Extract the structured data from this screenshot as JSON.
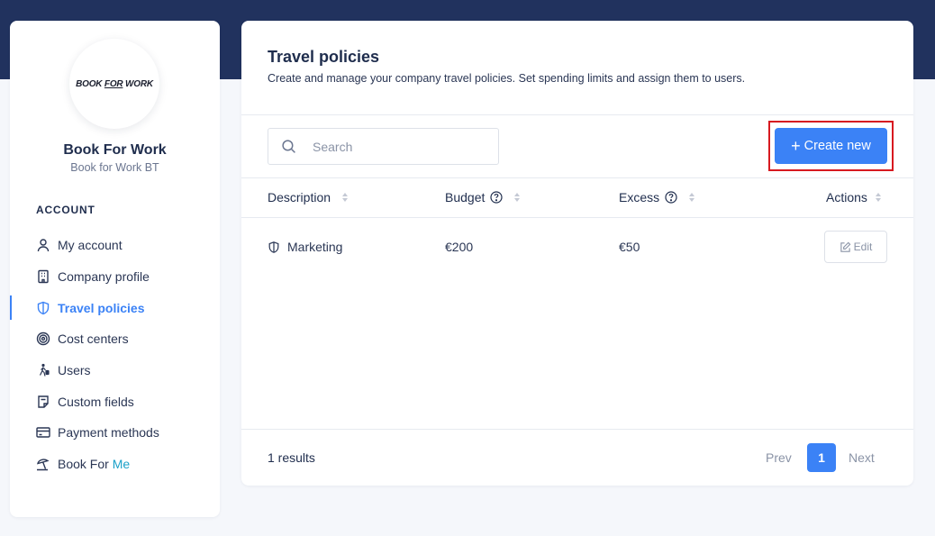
{
  "brand": {
    "logo_part1": "BOOK ",
    "logo_part2": "FOR",
    "logo_part3": " WORK",
    "company_name": "Book For Work",
    "company_sub": "Book for Work BT"
  },
  "sidebar": {
    "section_title": "ACCOUNT",
    "items": [
      {
        "label": "My account",
        "icon": "user-icon"
      },
      {
        "label": "Company profile",
        "icon": "building-icon"
      },
      {
        "label": "Travel policies",
        "icon": "shield-icon",
        "active": true
      },
      {
        "label": "Cost centers",
        "icon": "target-icon"
      },
      {
        "label": "Users",
        "icon": "walking-luggage-icon"
      },
      {
        "label": "Custom fields",
        "icon": "note-icon"
      },
      {
        "label": "Payment methods",
        "icon": "credit-card-icon"
      },
      {
        "label_part1": "Book For ",
        "label_part2": "Me",
        "icon": "beach-umbrella-icon"
      }
    ]
  },
  "main": {
    "title": "Travel policies",
    "description": "Create and manage your company travel policies. Set spending limits and assign them to users.",
    "search_placeholder": "Search",
    "create_label": "Create new",
    "columns": [
      "Description",
      "Budget",
      "Excess",
      "Actions"
    ],
    "rows": [
      {
        "description": "Marketing",
        "budget": "€200",
        "excess": "€50",
        "action": "Edit"
      }
    ],
    "results_label": "1 results",
    "pagination": {
      "prev": "Prev",
      "current": "1",
      "next": "Next"
    }
  },
  "colors": {
    "header_band": "#21325e",
    "accent": "#3b82f6",
    "highlight_border": "#d71920",
    "background": "#f5f7fb"
  }
}
